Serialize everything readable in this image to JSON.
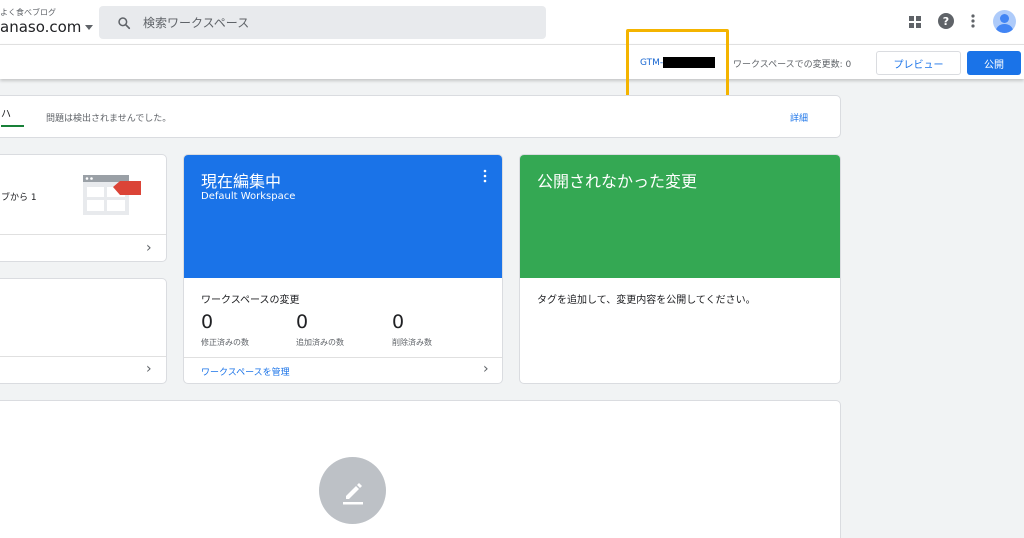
{
  "header": {
    "account_sub": "よく食べブログ",
    "account_name": "anaso.com",
    "search_placeholder": "検索ワークスペース",
    "icons": [
      "search-icon",
      "apps-icon",
      "help-icon",
      "more-vert-icon",
      "avatar"
    ]
  },
  "toolbar": {
    "container_id": "GTM-",
    "workspace_changes": "ワークスペースでの変更数: 0",
    "preview_label": "プレビュー",
    "publish_label": "公開"
  },
  "status": {
    "tab_label": "ハ",
    "message": "問題は検出されませんでした。",
    "detail_link": "詳細"
  },
  "left_card": {
    "text": "ブから 1"
  },
  "workspace_card": {
    "title": "現在編集中",
    "subtitle": "Default Workspace",
    "section_title": "ワークスペースの変更",
    "stats": [
      {
        "value": "0",
        "label": "修正済みの数"
      },
      {
        "value": "0",
        "label": "追加済みの数"
      },
      {
        "value": "0",
        "label": "削除済み数"
      }
    ],
    "manage_link": "ワークスペースを管理"
  },
  "unpublished_card": {
    "title": "公開されなかった変更",
    "message": "タグを追加して、変更内容を公開してください。"
  },
  "colors": {
    "primary_blue": "#1a73e8",
    "green": "#34a853",
    "highlight": "#f4b400"
  }
}
